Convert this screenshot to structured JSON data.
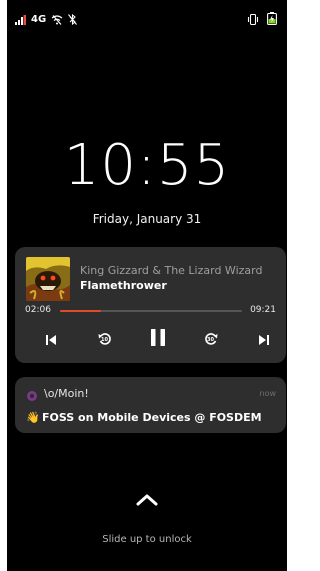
{
  "status_bar": {
    "network": "4G",
    "icons": [
      "signal-icon",
      "wifi-off-icon",
      "bluetooth-off-icon",
      "vibrate-icon",
      "battery-charging-icon"
    ]
  },
  "clock": {
    "time": "10:55",
    "date": "Friday, January 31"
  },
  "media": {
    "artist": "King Gizzard & The Lizard Wizard",
    "track": "Flamethrower",
    "elapsed": "02:06",
    "duration": "09:21",
    "progress": 0.225,
    "accent_color": "#e04a24",
    "controls": [
      "previous-icon",
      "replay-10-icon",
      "pause-icon",
      "forward-30-icon",
      "next-icon"
    ],
    "replay_label": "10",
    "forward_label": "30"
  },
  "notification": {
    "app_icon": "app-icon",
    "title": "\\o/Moin!",
    "time": "now",
    "emoji": "👋",
    "body": "FOSS on Mobile Devices @ FOSDEM"
  },
  "unlock": {
    "icon": "chevron-up-icon",
    "label": "Slide up to unlock"
  }
}
